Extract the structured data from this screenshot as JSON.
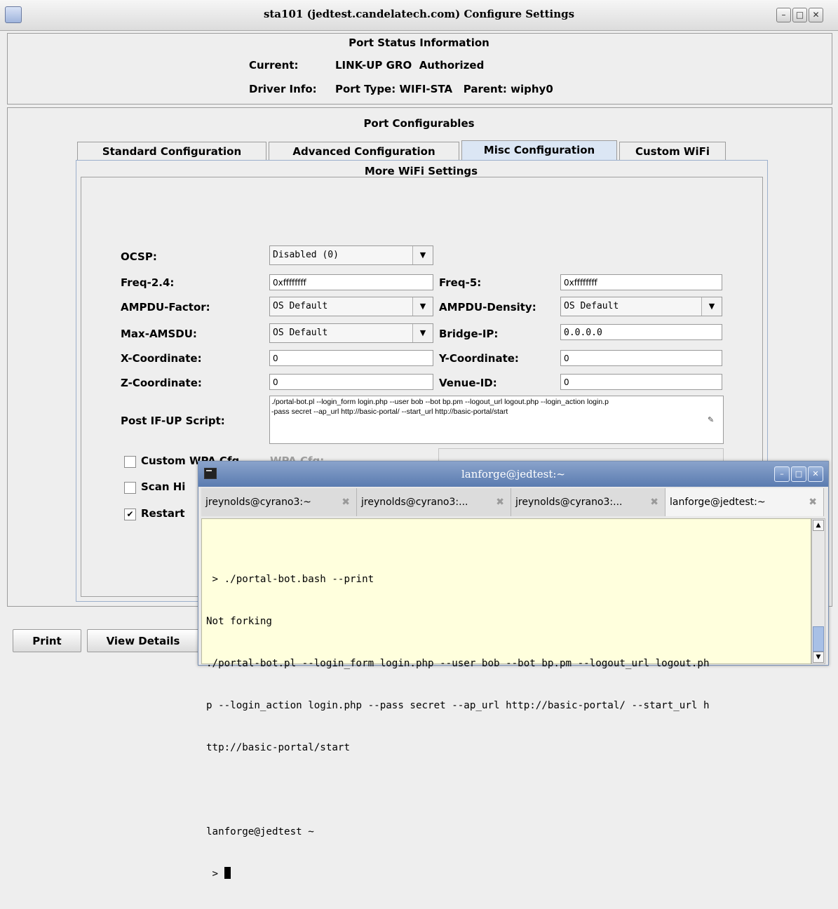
{
  "window": {
    "title": "sta101  (jedtest.candelatech.com) Configure Settings"
  },
  "status": {
    "header": "Port Status Information",
    "current_label": "Current:",
    "current_value": "LINK-UP GRO  Authorized",
    "driver_label": "Driver Info:",
    "driver_value": "Port Type: WIFI-STA   Parent: wiphy0"
  },
  "configurables": {
    "header": "Port Configurables"
  },
  "tabs": [
    {
      "label": "Standard Configuration",
      "selected": false
    },
    {
      "label": "Advanced Configuration",
      "selected": false
    },
    {
      "label": "Misc Configuration",
      "selected": true
    },
    {
      "label": "Custom WiFi",
      "selected": false
    }
  ],
  "wifi": {
    "header": "More WiFi Settings",
    "ocsp_label": "OCSP:",
    "ocsp_value": "Disabled (0)",
    "freq24_label": "Freq-2.4:",
    "freq24_value": "0xffffffff",
    "freq5_label": "Freq-5:",
    "freq5_value": "0xffffffff",
    "ampdu_factor_label": "AMPDU-Factor:",
    "ampdu_factor_value": "OS Default",
    "ampdu_density_label": "AMPDU-Density:",
    "ampdu_density_value": "OS Default",
    "max_amsdu_label": "Max-AMSDU:",
    "max_amsdu_value": "OS Default",
    "bridge_ip_label": "Bridge-IP:",
    "bridge_ip_value": "0.0.0.0",
    "x_label": "X-Coordinate:",
    "x_value": "0",
    "y_label": "Y-Coordinate:",
    "y_value": "0",
    "z_label": "Z-Coordinate:",
    "z_value": "0",
    "venue_label": "Venue-ID:",
    "venue_value": "0",
    "script_label": "Post IF-UP Script:",
    "script_line1": "./portal-bot.pl --login_form login.php --user bob --bot bp.pm --logout_url logout.php --login_action login.p",
    "script_line2": "-pass secret --ap_url http://basic-portal/ --start_url http://basic-portal/start",
    "custom_wpa_label": "Custom WPA Cfg",
    "custom_wpa_checked": false,
    "wpa_cfg_label": "WPA Cfg:",
    "scan_label": "Scan Hi",
    "scan_checked": false,
    "restart_label": "Restart",
    "restart_checked": true
  },
  "buttons": {
    "print": "Print",
    "view_details": "View Details"
  },
  "terminal": {
    "title": "lanforge@jedtest:~",
    "tabs": [
      {
        "label": "jreynolds@cyrano3:~",
        "selected": false
      },
      {
        "label": "jreynolds@cyrano3:...",
        "selected": false
      },
      {
        "label": "jreynolds@cyrano3:...",
        "selected": false
      },
      {
        "label": "lanforge@jedtest:~",
        "selected": true
      }
    ],
    "lines": [
      " > ./portal-bot.bash --print",
      "Not forking",
      "./portal-bot.pl --login_form login.php --user bob --bot bp.pm --logout_url logout.ph",
      "p --login_action login.php --pass secret --ap_url http://basic-portal/ --start_url h",
      "ttp://basic-portal/start",
      "",
      "lanforge@jedtest ~",
      " > "
    ]
  }
}
